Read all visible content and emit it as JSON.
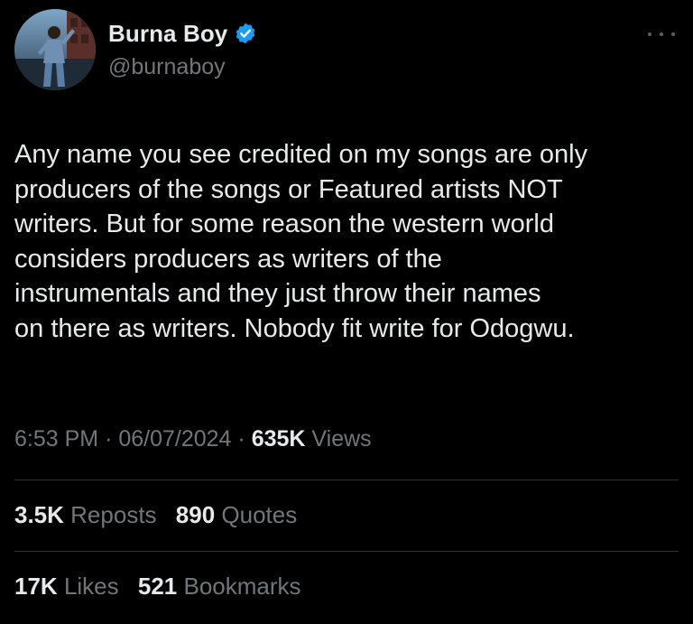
{
  "author": {
    "display_name": "Burna Boy",
    "handle": "@burnaboy",
    "verified": true,
    "verified_color": "#1d9bf0",
    "avatar_icon": "avatar-photo"
  },
  "more_icon": "more-options-icon",
  "tweet": {
    "text": "Any name you see credited on my songs are only\nproducers of the songs or Featured artists NOT\nwriters. But for some reason the western world\nconsiders producers as writers of the\ninstrumentals and they just throw their names\non there as writers. Nobody fit write for Odogwu."
  },
  "meta": {
    "time": "6:53 PM",
    "dot1": "·",
    "date": "06/07/2024",
    "dot2": "·",
    "views_count": "635K",
    "views_label": "Views"
  },
  "engagement": {
    "reposts_count": "3.5K",
    "reposts_label": "Reposts",
    "quotes_count": "890",
    "quotes_label": "Quotes",
    "likes_count": "17K",
    "likes_label": "Likes",
    "bookmarks_count": "521",
    "bookmarks_label": "Bookmarks"
  },
  "colors": {
    "background": "#000000",
    "text_primary": "#e7e9ea",
    "text_secondary": "#71767b",
    "divider": "#2f3336"
  }
}
